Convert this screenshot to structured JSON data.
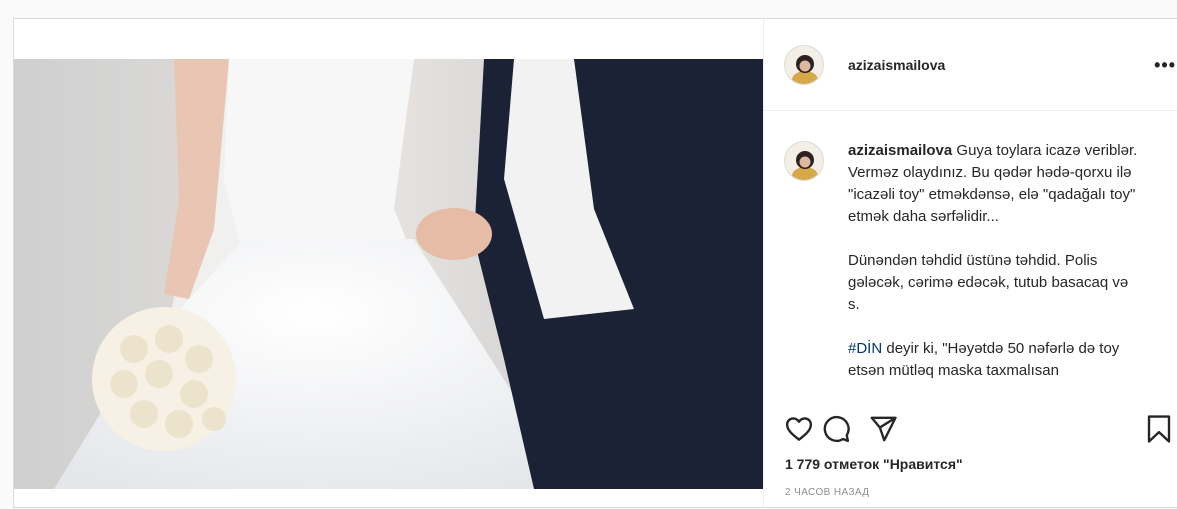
{
  "post": {
    "username": "azizaismailova",
    "more_icon": "more-horizontal-icon",
    "caption": {
      "username": "azizaismailova",
      "paragraph1": "Guya toylara icazə veriblər. Verməz olaydınız. Bu qədər hədə-qorxu ilə \"icazəli toy\" etməkdənsə, elə \"qadağalı toy\" etmək daha sərfəlidir...",
      "paragraph2": "Dünəndən təhdid üstünə təhdid. Polis gələcək, cərimə edəcək, tutub basacaq və s.",
      "hashtag": "#DİN",
      "paragraph3_rest": " deyir ki, \"Həyətdə 50 nəfərlə də toy etsən mütləq maska taxmalısan"
    },
    "actions": {
      "like_icon": "heart-icon",
      "comment_icon": "comment-icon",
      "share_icon": "send-icon",
      "save_icon": "bookmark-icon"
    },
    "likes_text": "1 779 отметок \"Нравится\"",
    "time_text": "2 ЧАСОВ НАЗАД"
  },
  "colors": {
    "text": "#262626",
    "secondary": "#8e8e8e",
    "hashtag": "#00376b",
    "border": "#dbdbdb"
  }
}
